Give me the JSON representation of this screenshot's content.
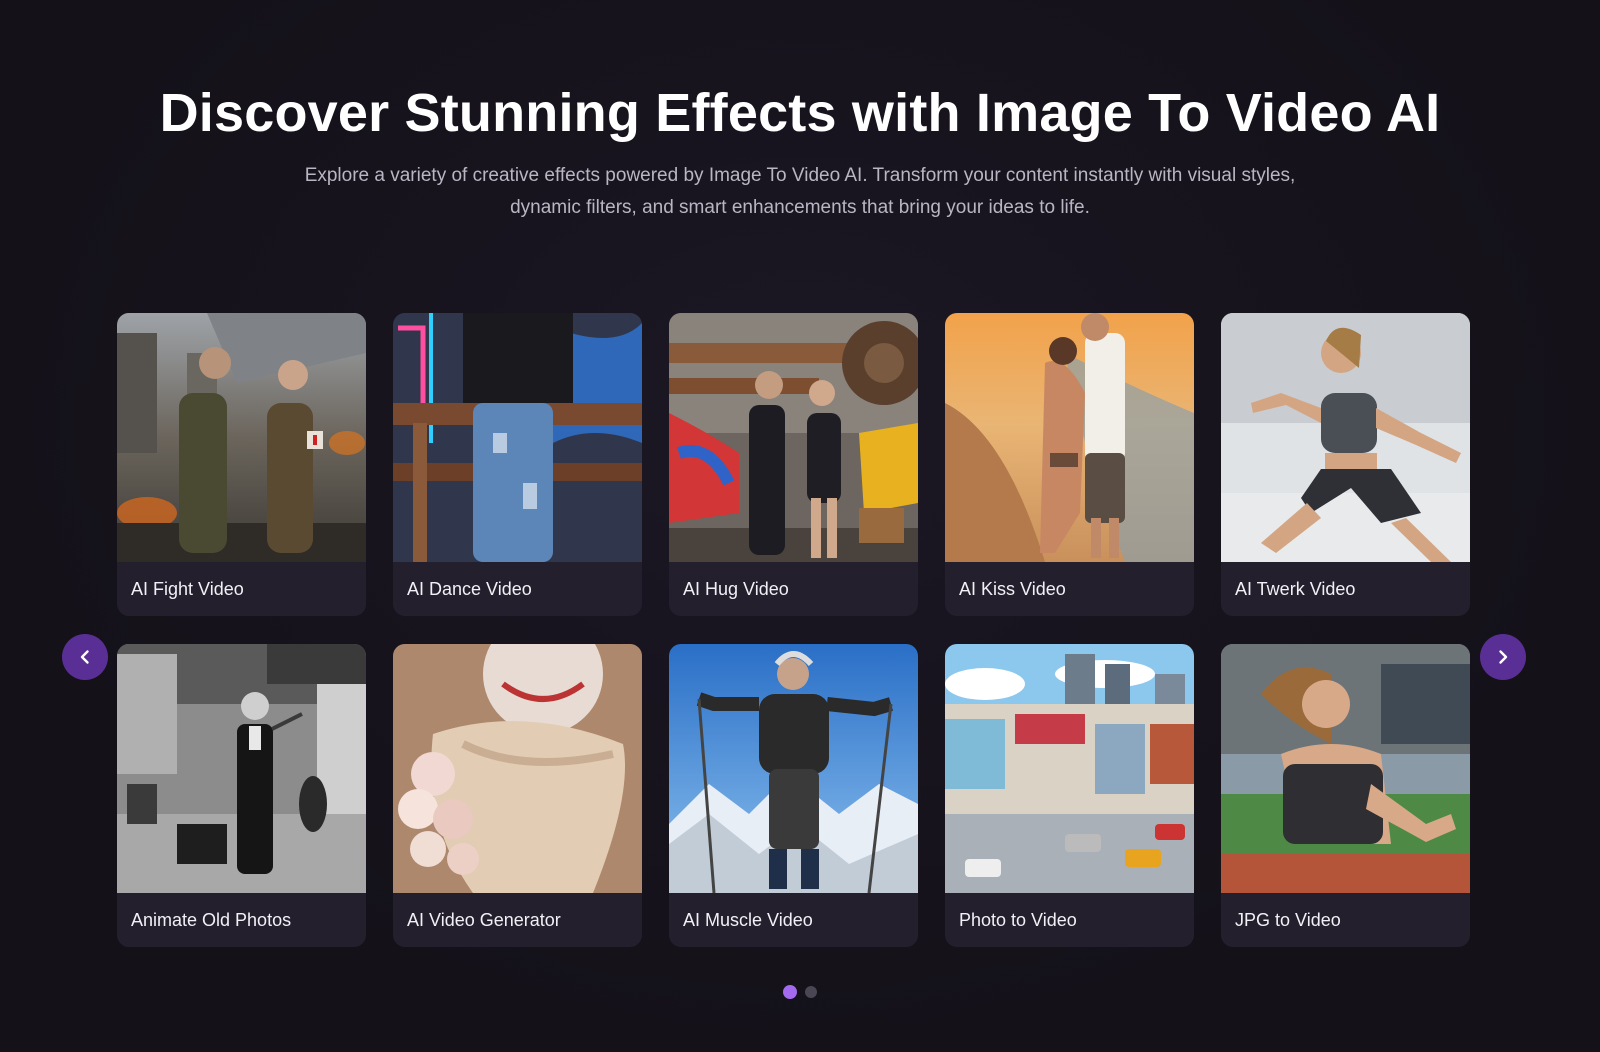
{
  "header": {
    "title": "Discover Stunning Effects with Image To Video AI",
    "subtitle": "Explore a variety of creative effects powered by Image To Video AI. Transform your content instantly with visual styles, dynamic filters, and smart enhancements that bring your ideas to life."
  },
  "cards": [
    {
      "label": "AI Fight Video"
    },
    {
      "label": "AI Dance Video"
    },
    {
      "label": "AI Hug Video"
    },
    {
      "label": "AI Kiss Video"
    },
    {
      "label": "AI Twerk Video"
    },
    {
      "label": "Animate Old Photos"
    },
    {
      "label": "AI Video Generator"
    },
    {
      "label": "AI Muscle Video"
    },
    {
      "label": "Photo to Video"
    },
    {
      "label": "JPG to Video"
    }
  ],
  "carousel": {
    "prev_icon": "chevron-left-icon",
    "next_icon": "chevron-right-icon",
    "pages": 2,
    "active_page": 1
  },
  "colors": {
    "background": "#16131d",
    "card": "#231f2d",
    "accent": "#a36af0",
    "nav_button": "#5a2f95"
  }
}
